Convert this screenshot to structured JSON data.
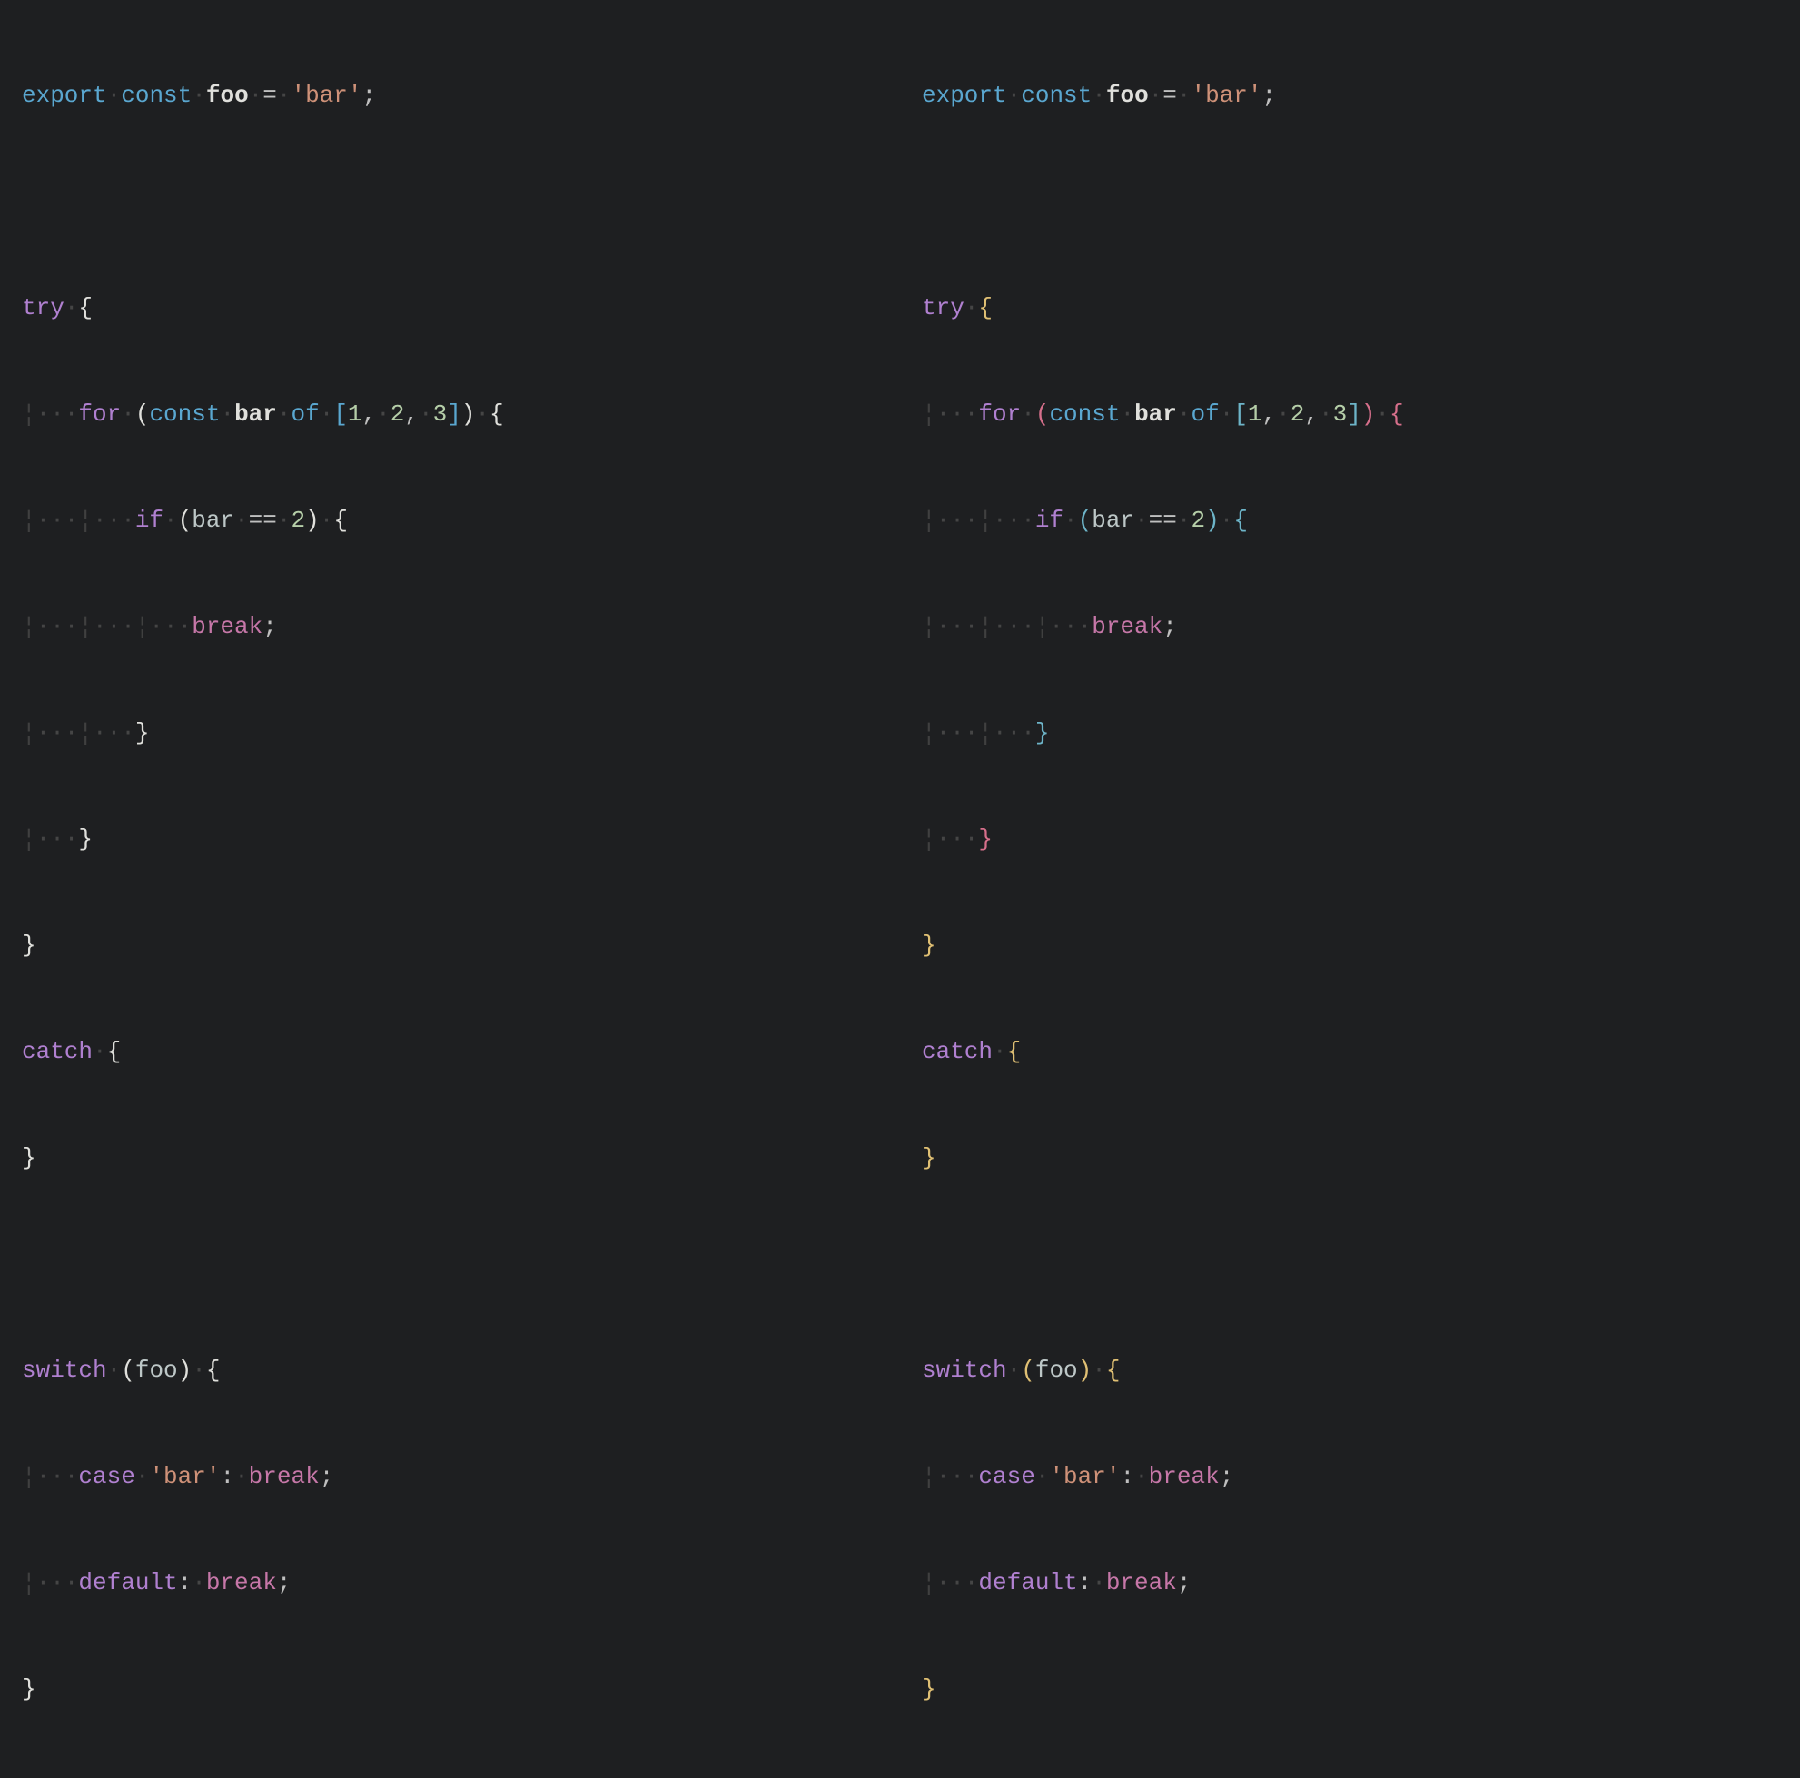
{
  "left": {
    "tokens": {
      "export": "export",
      "const": "const",
      "foo": "foo",
      "eq": "=",
      "strbar": "'bar'",
      "semi": ";",
      "try": "try",
      "lbrace": "{",
      "rbrace": "}",
      "for": "for",
      "lparen": "(",
      "rparen": ")",
      "bar": "bar",
      "of": "of",
      "lbracket": "[",
      "rbracket": "]",
      "n1": "1",
      "n2": "2",
      "n3": "3",
      "comma": ",",
      "if": "if",
      "eqeq": "==",
      "break": "break",
      "catch": "catch",
      "switch": "switch",
      "case": "case",
      "colon": ":",
      "default": "default"
    }
  },
  "right": {
    "tokens": {
      "export": "export",
      "const": "const",
      "foo": "foo",
      "eq": "=",
      "strbar": "'bar'",
      "semi": ";",
      "try": "try",
      "lbrace": "{",
      "rbrace": "}",
      "for": "for",
      "lparen": "(",
      "rparen": ")",
      "bar": "bar",
      "of": "of",
      "lbracket": "[",
      "rbracket": "]",
      "n1": "1",
      "n2": "2",
      "n3": "3",
      "comma": ",",
      "if": "if",
      "eqeq": "==",
      "break": "break",
      "catch": "catch",
      "switch": "switch",
      "case": "case",
      "colon": ":",
      "default": "default"
    }
  }
}
